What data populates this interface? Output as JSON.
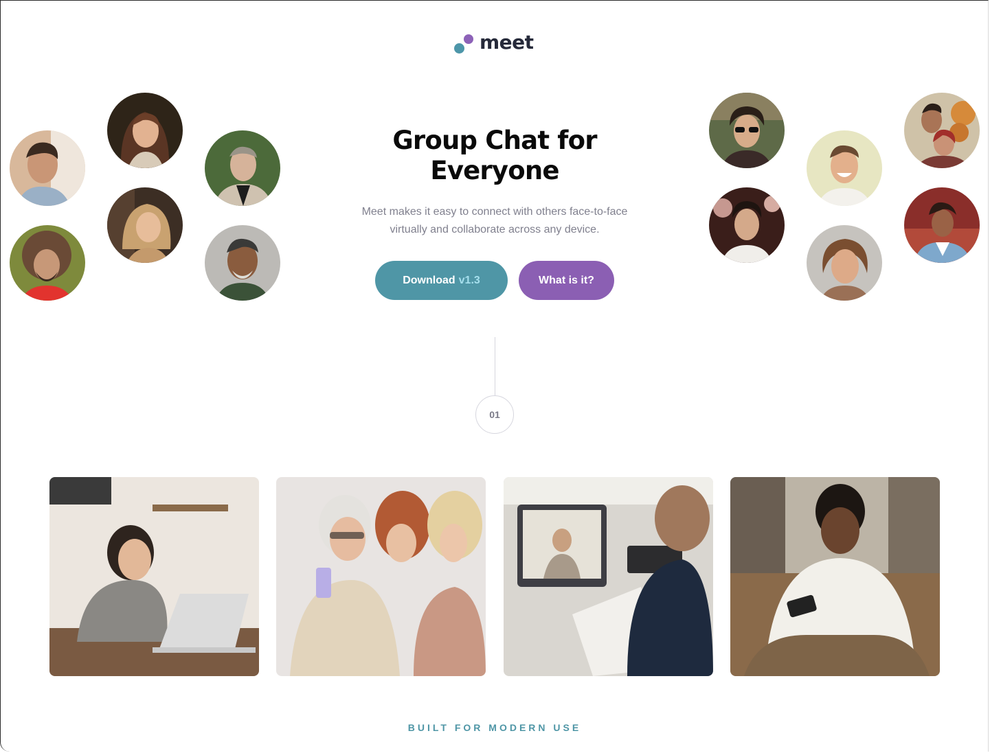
{
  "brand": {
    "name": "meet",
    "logo_icon": "meet-logo-icon",
    "colors": {
      "teal": "#4d96a9",
      "purple": "#8d62b8",
      "dark": "#262a3a"
    }
  },
  "hero": {
    "title": "Group Chat for Everyone",
    "subtitle": "Meet makes it easy to connect with others face-to-face virtually and collaborate across any device.",
    "download_button": {
      "label": "Download",
      "version": "v1.3"
    },
    "what_button": {
      "label": "What is it?"
    }
  },
  "avatars_left": [
    "avatar-young-man",
    "avatar-smiling-woman",
    "avatar-man-jacket",
    "avatar-curly-man",
    "avatar-blonde-woman",
    "avatar-older-man"
  ],
  "avatars_right": [
    "avatar-man-sunglasses",
    "avatar-smiling-man",
    "avatar-couple",
    "avatar-dark-hair-man",
    "avatar-wavy-hair-man",
    "avatar-woman-denim"
  ],
  "step": {
    "number": "01"
  },
  "photos": [
    "photo-woman-laptop",
    "photo-women-phone",
    "photo-man-video-call",
    "photo-man-phone"
  ],
  "section": {
    "label": "BUILT FOR MODERN USE"
  }
}
